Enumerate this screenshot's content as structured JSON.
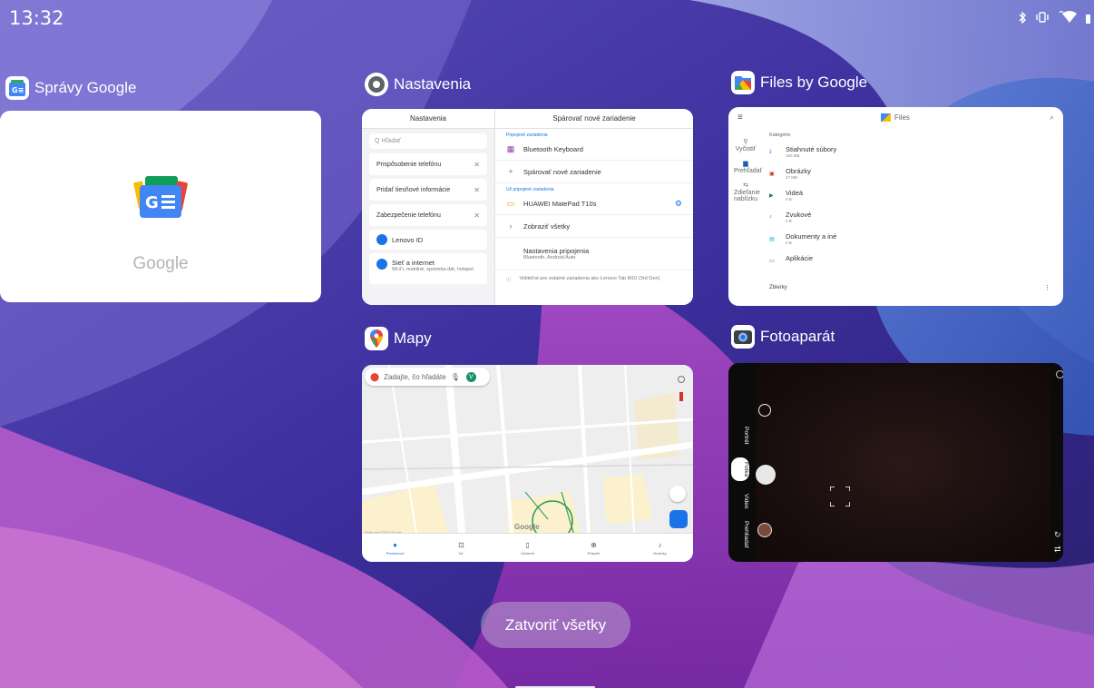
{
  "status_bar": {
    "time": "13:32",
    "icons": [
      "bluetooth-icon",
      "vibrate-icon",
      "wifi-icon",
      "battery-icon"
    ]
  },
  "apps": {
    "news": {
      "title": "Správy Google",
      "icon": "google-news-icon",
      "preview_word": "Google"
    },
    "settings": {
      "title": "Nastavenia",
      "icon": "settings-gear-icon",
      "left_header": "Nastavenia",
      "right_header": "Spárovať nové zariadenie",
      "search_placeholder": "Hľadať",
      "suggestions": [
        "Prispôsobenie telefónu",
        "Pridať tiesňové informácie",
        "Zabezpečenie telefónu"
      ],
      "lenovo_id": "Lenovo ID",
      "network_title": "Sieť a internet",
      "network_sub": "Wi-Fi, mobilné, spotreba dát, hotspot",
      "section_connected": "Pripojené zariadenia",
      "bt_keyboard": "Bluetooth Keyboard",
      "pair_new": "Spárovať nové zariadenie",
      "section_previous": "Už pripojené zariadenia",
      "huawei": "HUAWEI MatePad T10s",
      "show_all": "Zobraziť všetky",
      "conn_prefs": "Nastavenia pripojenia",
      "conn_prefs_sub": "Bluetooth, Android Auto",
      "footer": "Viditeľné pre ostatné zariadenia ako Lenovo Tab M10 (3rd Gen)"
    },
    "files": {
      "title": "Files by Google",
      "icon": "files-by-google-icon",
      "brand": "Files",
      "rail": [
        "Vyčistiť",
        "Prehľadať",
        "Zdieľanie nablízku"
      ],
      "kategoria": "Kategórie",
      "items": [
        {
          "name": "Stiahnuté súbory",
          "size": "160 MB"
        },
        {
          "name": "Obrázky",
          "size": "27 MB"
        },
        {
          "name": "Videá",
          "size": "0 B"
        },
        {
          "name": "Zvukové",
          "size": "0 B"
        },
        {
          "name": "Dokumenty a iné",
          "size": "0 B"
        },
        {
          "name": "Aplikácie",
          "size": ""
        }
      ],
      "collections": "Zbierky"
    },
    "maps": {
      "title": "Mapy",
      "icon": "google-maps-icon",
      "search_placeholder": "Zadajte, čo hľadáte",
      "avatar_letter": "V",
      "google_word": "Google",
      "copyright": "Údaje máp ©2022 Google",
      "tabs": [
        "Preskúmať",
        "Ísť",
        "Uložené",
        "Prispieť",
        "Novinky"
      ]
    },
    "camera": {
      "title": "Fotoaparát",
      "icon": "camera-icon",
      "modes": [
        "Portrét",
        "Fotka",
        "Video",
        "Prehliadať"
      ]
    }
  },
  "close_all_label": "Zatvoriť všetky"
}
